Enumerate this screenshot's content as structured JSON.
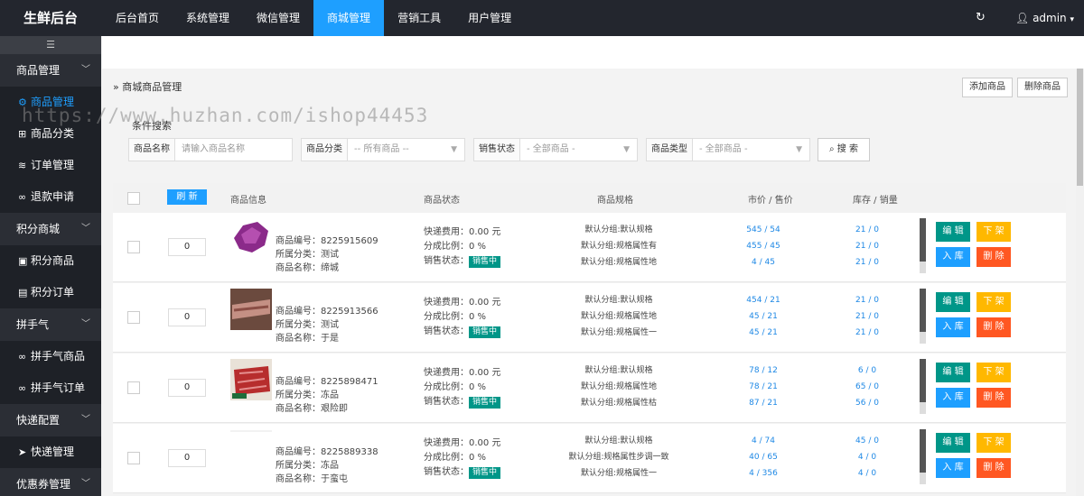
{
  "app": {
    "title": "生鲜后台"
  },
  "nav": [
    "后台首页",
    "系统管理",
    "微信管理",
    "商城管理",
    "营销工具",
    "用户管理"
  ],
  "user": {
    "name": "admin"
  },
  "sidebar": {
    "toggle": "☰",
    "groups": [
      {
        "label": "商品管理",
        "items": [
          {
            "label": "商品管理",
            "icon": "gear-icon"
          },
          {
            "label": "商品分类",
            "icon": "grid-icon"
          },
          {
            "label": "订单管理",
            "icon": "layers-icon"
          },
          {
            "label": "退款申请",
            "icon": "link-icon"
          }
        ]
      },
      {
        "label": "积分商城",
        "items": [
          {
            "label": "积分商品",
            "icon": "box-icon"
          },
          {
            "label": "积分订单",
            "icon": "doc-icon"
          }
        ]
      },
      {
        "label": "拼手气",
        "items": [
          {
            "label": "拼手气商品",
            "icon": "link-icon"
          },
          {
            "label": "拼手气订单",
            "icon": "link-icon"
          }
        ]
      },
      {
        "label": "快递配置",
        "items": [
          {
            "label": "快递管理",
            "icon": "send-icon"
          }
        ]
      },
      {
        "label": "优惠券管理",
        "items": []
      }
    ]
  },
  "page": {
    "breadcrumb": "商城商品管理",
    "add_button": "添加商品",
    "delete_button": "删除商品",
    "watermark": "https://www.huzhan.com/ishop44453",
    "search_title": "条件搜索"
  },
  "filters": {
    "name": {
      "label": "商品名称",
      "placeholder": "请输入商品名称"
    },
    "category": {
      "label": "商品分类",
      "value": "-- 所有商品 --"
    },
    "sale_status": {
      "label": "销售状态",
      "value": "- 全部商品 -"
    },
    "type": {
      "label": "商品类型",
      "value": "- 全部商品 -"
    },
    "search_button": "搜 索"
  },
  "table": {
    "refresh_button": "刷 新",
    "headers": {
      "info": "商品信息",
      "status": "商品状态",
      "spec": "商品规格",
      "price": "市价 / 售价",
      "stock": "库存 / 销量"
    },
    "rows": [
      {
        "qty": "0",
        "code": "商品编号：8225915609",
        "category": "所属分类：测试",
        "name": "商品名称：缔城",
        "shipping": "快递费用：0.00 元",
        "ratio": "分成比例：0 %",
        "sale_label": "销售状态：",
        "sale_badge": "销售中",
        "specs": [
          "默认分组:默认规格",
          "默认分组:规格属性有",
          "默认分组:规格属性地"
        ],
        "prices": [
          "545 / 54",
          "455 / 45",
          "4 / 45"
        ],
        "stocks": [
          "21 / 0",
          "21 / 0",
          "21 / 0"
        ],
        "thumb_color": "#8b2a8a"
      },
      {
        "qty": "0",
        "code": "商品编号：8225913566",
        "category": "所属分类：测试",
        "name": "商品名称：于是",
        "shipping": "快递费用：0.00 元",
        "ratio": "分成比例：0 %",
        "sale_label": "销售状态：",
        "sale_badge": "销售中",
        "specs": [
          "默认分组:默认规格",
          "默认分组:规格属性地",
          "默认分组:规格属性一"
        ],
        "prices": [
          "454 / 21",
          "45 / 21",
          "45 / 21"
        ],
        "stocks": [
          "21 / 0",
          "21 / 0",
          "21 / 0"
        ],
        "thumb_color": "#a0675a"
      },
      {
        "qty": "0",
        "code": "商品编号：8225898471",
        "category": "所属分类：冻品",
        "name": "商品名称：艰险即",
        "shipping": "快递费用：0.00 元",
        "ratio": "分成比例：0 %",
        "sale_label": "销售状态：",
        "sale_badge": "销售中",
        "specs": [
          "默认分组:默认规格",
          "默认分组:规格属性地",
          "默认分组:规格属性枯"
        ],
        "prices": [
          "78 / 12",
          "78 / 21",
          "87 / 21"
        ],
        "stocks": [
          "6 / 0",
          "65 / 0",
          "56 / 0"
        ],
        "thumb_color": "#b72d2d"
      },
      {
        "qty": "0",
        "code": "商品编号：8225889338",
        "category": "所属分类：冻品",
        "name": "商品名称：于蛮屯",
        "shipping": "快递费用：0.00 元",
        "ratio": "分成比例：0 %",
        "sale_label": "销售状态：",
        "sale_badge": "销售中",
        "specs": [
          "默认分组:默认规格",
          "默认分组:规格属性步调一致",
          "默认分组:规格属性一"
        ],
        "prices": [
          "4 / 74",
          "40 / 65",
          "4 / 356"
        ],
        "stocks": [
          "45 / 0",
          "4 / 0",
          "4 / 0"
        ],
        "thumb_color": "#ffffff"
      }
    ],
    "actions": {
      "edit": "编 辑",
      "off_shelf": "下 架",
      "stock_in": "入 库",
      "delete": "删 除"
    }
  }
}
